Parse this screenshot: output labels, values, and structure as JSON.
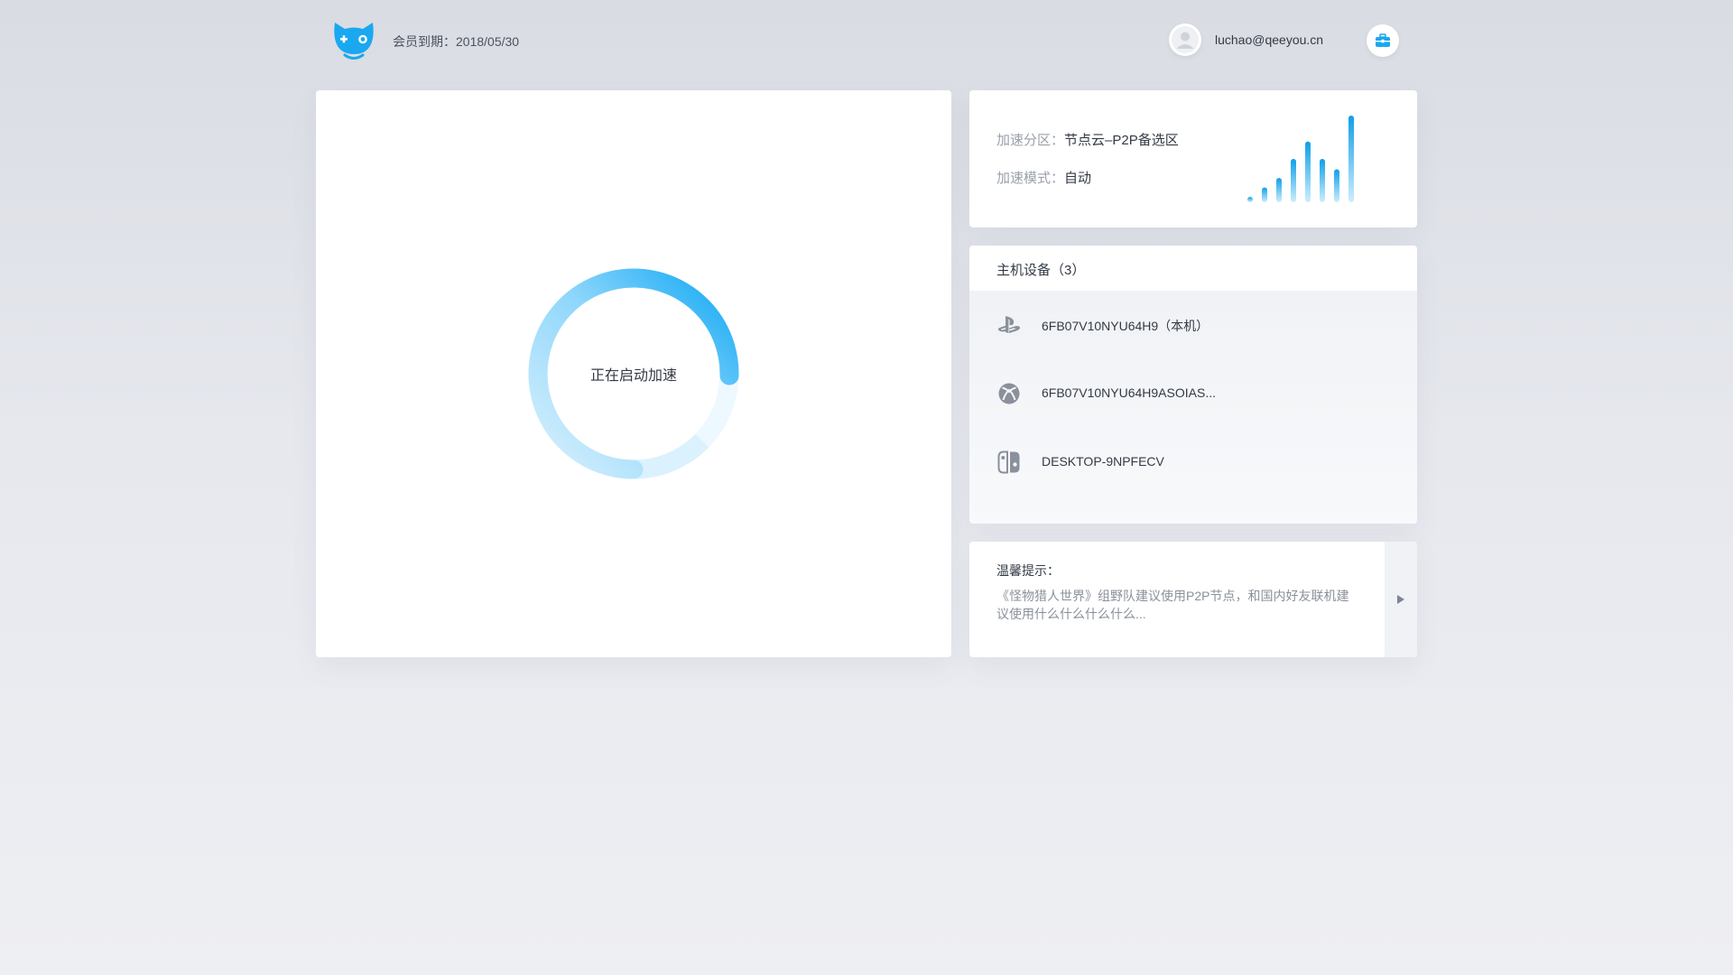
{
  "header": {
    "logo_icon": "cat-gamepad-logo-icon",
    "membership_label": "会员到期：",
    "membership_date": "2018/05/30",
    "avatar_icon": "user-avatar-icon",
    "user_email": "luchao@qeeyou.cn",
    "toolbox_icon": "toolbox-icon"
  },
  "main": {
    "status_text": "正在启动加速",
    "progress_ring_icon": "loading-ring-icon"
  },
  "info": {
    "zone_label": "加速分区：",
    "zone_value": "节点云–P2P备选区",
    "mode_label": "加速模式：",
    "mode_value": "自动",
    "signal_icon": "signal-bars-icon",
    "signal_levels": [
      0.06,
      0.17,
      0.28,
      0.5,
      0.7,
      0.5,
      0.38,
      1.0
    ]
  },
  "devices": {
    "title": "主机设备（3）",
    "items": [
      {
        "icon": "playstation-icon",
        "name": "6FB07V10NYU64H9（本机）"
      },
      {
        "icon": "xbox-icon",
        "name": "6FB07V10NYU64H9ASOIAS..."
      },
      {
        "icon": "nintendo-switch-icon",
        "name": "DESKTOP-9NPFECV"
      }
    ]
  },
  "tip": {
    "title": "温馨提示：",
    "text": "《怪物猎人世界》组野队建议使用P2P节点，和国内好友联机建议使用什么什么什么什么...",
    "arrow_icon": "triangle-right-icon"
  },
  "colors": {
    "accent": "#1aa8f0",
    "background": "#e2e4ea",
    "text_primary": "#333a44",
    "text_secondary": "#9aa0ab"
  }
}
